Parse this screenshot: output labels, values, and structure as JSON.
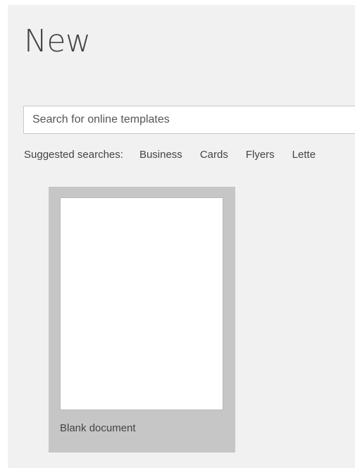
{
  "header": {
    "title": "New"
  },
  "search": {
    "placeholder": "Search for online templates",
    "value": ""
  },
  "suggested": {
    "label": "Suggested searches:",
    "items": [
      "Business",
      "Cards",
      "Flyers",
      "Lette"
    ]
  },
  "templates": [
    {
      "label": "Blank document"
    }
  ]
}
